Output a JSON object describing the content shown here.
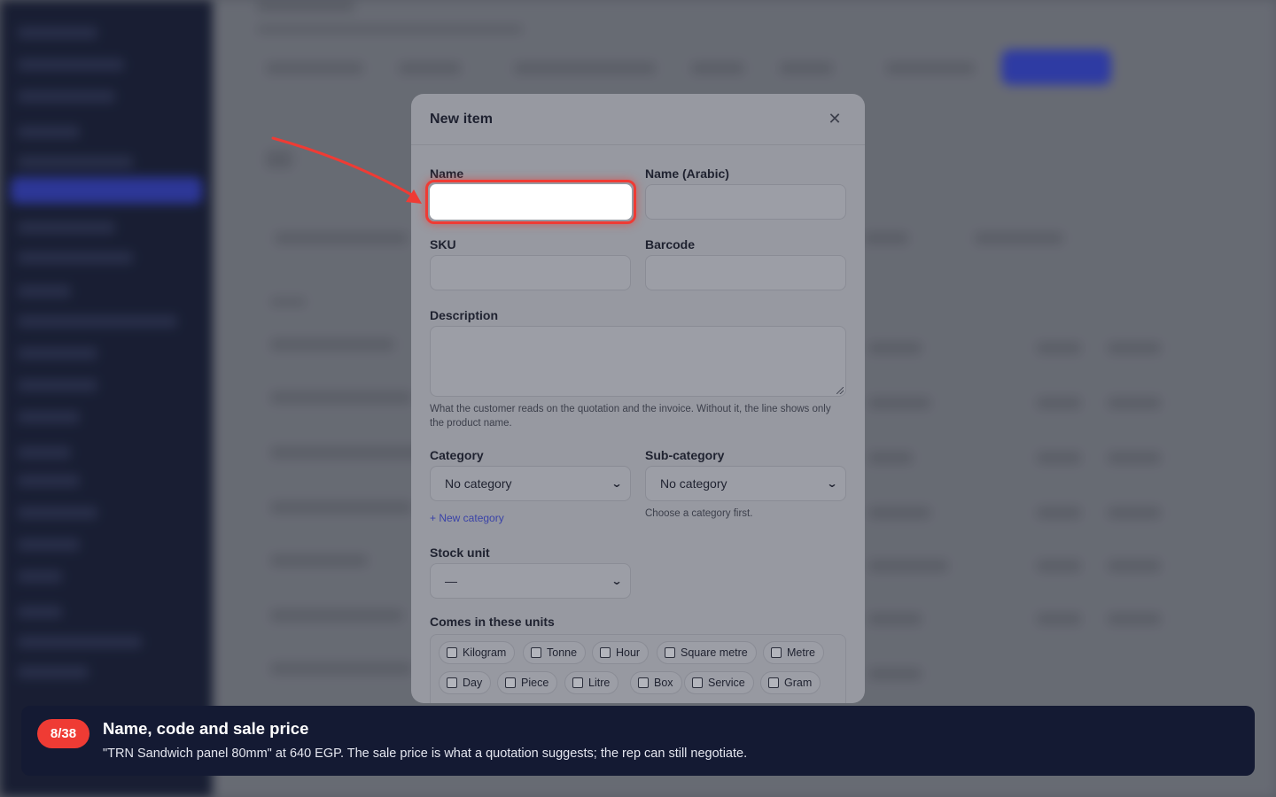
{
  "modal": {
    "title": "New item",
    "close_icon": "close-icon",
    "fields": {
      "name_label": "Name",
      "name_value": "",
      "name_ar_label": "Name (Arabic)",
      "sku_label": "SKU",
      "barcode_label": "Barcode",
      "description_label": "Description",
      "description_hint": "What the customer reads on the quotation and the invoice. Without it, the line shows only the product name.",
      "category_label": "Category",
      "category_value": "No category",
      "new_category_link": "+ New category",
      "subcategory_label": "Sub-category",
      "subcategory_value": "No category",
      "subcategory_hint": "Choose a category first.",
      "stock_unit_label": "Stock unit",
      "stock_unit_value": "—",
      "units_label": "Comes in these units",
      "units": [
        "Kilogram",
        "Tonne",
        "Hour",
        "Square metre",
        "Metre",
        "Day",
        "Piece",
        "Litre",
        "Box",
        "Service",
        "Gram"
      ]
    }
  },
  "tour": {
    "step": "8/38",
    "title": "Name, code and sale price",
    "text": "\"TRN Sandwich panel 80mm\" at 640 EGP. The sale price is what a quotation suggests; the rep can still negotiate.",
    "highlight_color": "#ef3b34",
    "banner_color": "#141a33"
  }
}
